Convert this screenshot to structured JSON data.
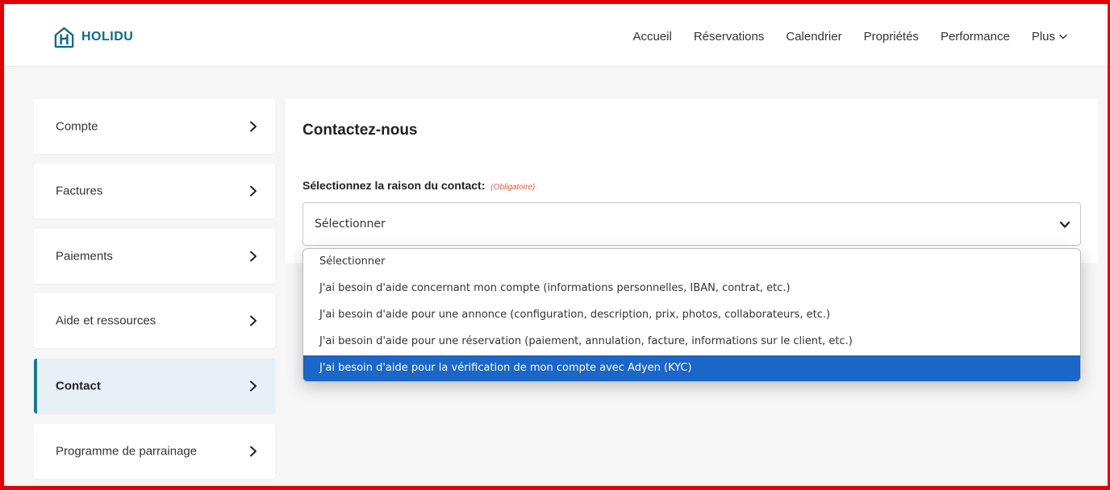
{
  "brand": {
    "name": "HOLIDU",
    "color": "#0a6b8a"
  },
  "nav": {
    "items": [
      "Accueil",
      "Réservations",
      "Calendrier",
      "Propriétés",
      "Performance"
    ],
    "more": "Plus"
  },
  "sidebar": {
    "items": [
      {
        "label": "Compte",
        "active": false
      },
      {
        "label": "Factures",
        "active": false
      },
      {
        "label": "Paiements",
        "active": false
      },
      {
        "label": "Aide et ressources",
        "active": false
      },
      {
        "label": "Contact",
        "active": true
      },
      {
        "label": "Programme de parrainage",
        "active": false
      }
    ]
  },
  "contact": {
    "title": "Contactez-nous",
    "field_label": "Sélectionnez la raison du contact:",
    "required_note": "(Obligatoire)",
    "selected_value": "Sélectionner",
    "options": [
      "Sélectionner",
      "J'ai besoin d'aide concernant mon compte (informations personnelles, IBAN, contrat, etc.)",
      "J'ai besoin d'aide pour une annonce (configuration, description, prix, photos, collaborateurs, etc.)",
      "J'ai besoin d'aide pour une réservation (paiement, annulation, facture, informations sur le client, etc.)",
      "J'ai besoin d'aide pour la vérification de mon compte avec Adyen (KYC)"
    ],
    "highlighted_option_index": 4
  },
  "colors": {
    "accent": "#137b96",
    "highlight": "#1a66c9",
    "required": "#e0593c",
    "frame": "#e30000"
  },
  "icons": {
    "logo": "holidu-house-icon",
    "sidebar_arrow": "chevron-right-icon",
    "select_caret": "chevron-down-icon"
  }
}
